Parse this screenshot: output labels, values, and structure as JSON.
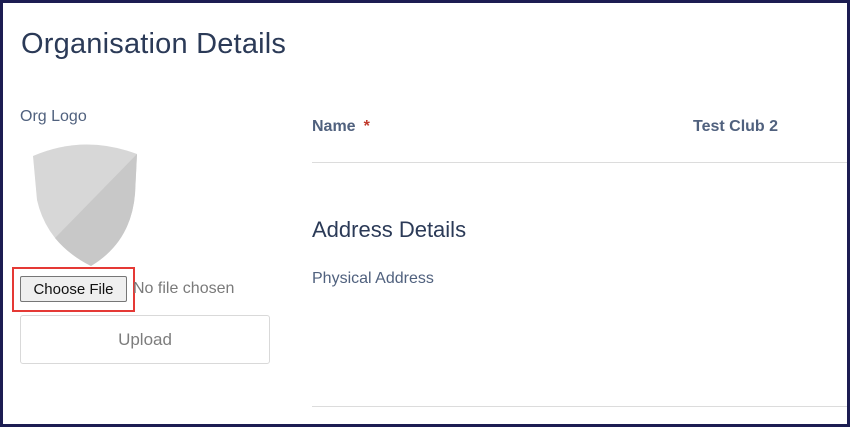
{
  "page": {
    "title": "Organisation Details"
  },
  "logo_section": {
    "label": "Org Logo",
    "logo_icon": "shield-placeholder-icon",
    "choose_file_label": "Choose File",
    "no_file_text": "No file chosen",
    "upload_label": "Upload"
  },
  "details": {
    "name_label": "Name",
    "required_marker": "*",
    "name_value": "Test Club 2",
    "address_heading": "Address Details",
    "physical_address_label": "Physical Address"
  },
  "colors": {
    "frame_border": "#1c1d52",
    "highlight": "#e53935",
    "required": "#c0392b",
    "heading": "#2b3a57",
    "label": "#50617e"
  }
}
